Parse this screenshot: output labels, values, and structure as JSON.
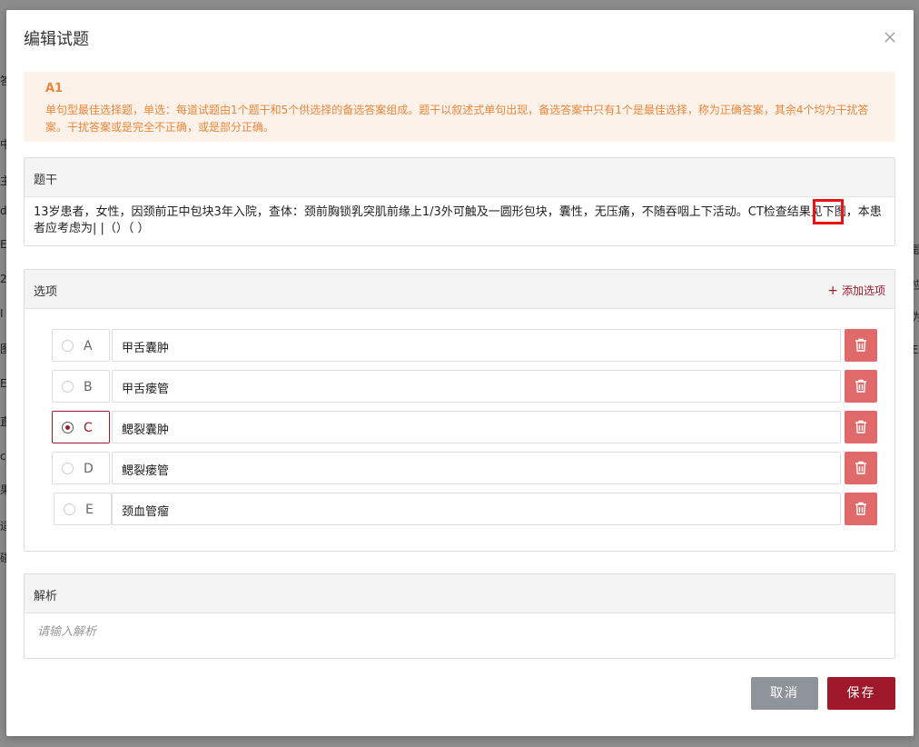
{
  "dialog": {
    "title": "编辑试题",
    "close_icon": "close-icon"
  },
  "backdrop": {
    "left_glyphs": [
      "答",
      "中",
      "主",
      "d",
      "E",
      "2",
      "I",
      "图",
      "E",
      "直",
      "c",
      "果",
      "适",
      "碰"
    ],
    "right_glyphs": [
      "题",
      "应",
      "为",
      "E"
    ]
  },
  "notice": {
    "type": "A1",
    "description": "单句型最佳选择题，单选：每道试题由1个题干和5个供选择的备选答案组成。题干以叙述式单句出现，备选答案中只有1个是最佳选择，称为正确答案，其余4个均为干扰答案。干扰答案或是完全不正确，或是部分正确。"
  },
  "stem": {
    "label": "题干",
    "text": "13岁患者，女性，因颈前正中包块3年入院，查体：颈前胸锁乳突肌前缘上1/3外可触及一圆形包块，囊性，无压痛，不随吞咽上下活动。CT检查结果见下图，本患者应考虑为|   |（）（ ）"
  },
  "options": {
    "label": "选项",
    "add_label": "添加选项",
    "items": [
      {
        "letter": "A",
        "value": "甲舌囊肿",
        "checked": false
      },
      {
        "letter": "B",
        "value": "甲舌瘘管",
        "checked": false
      },
      {
        "letter": "C",
        "value": "鳃裂囊肿",
        "checked": true
      },
      {
        "letter": "D",
        "value": "鳃裂瘘管",
        "checked": false
      },
      {
        "letter": "E",
        "value": "颈血管瘤",
        "checked": false
      }
    ]
  },
  "analysis": {
    "label": "解析",
    "placeholder": "请输入解析"
  },
  "buttons": {
    "cancel": "取消",
    "save": "保存"
  },
  "colors": {
    "accent": "#a0192b",
    "notice_bg": "#fdf2ea",
    "notice_text": "#e8873b",
    "delete_bg": "#e06a6a",
    "cancel_bg": "#8f939a"
  }
}
